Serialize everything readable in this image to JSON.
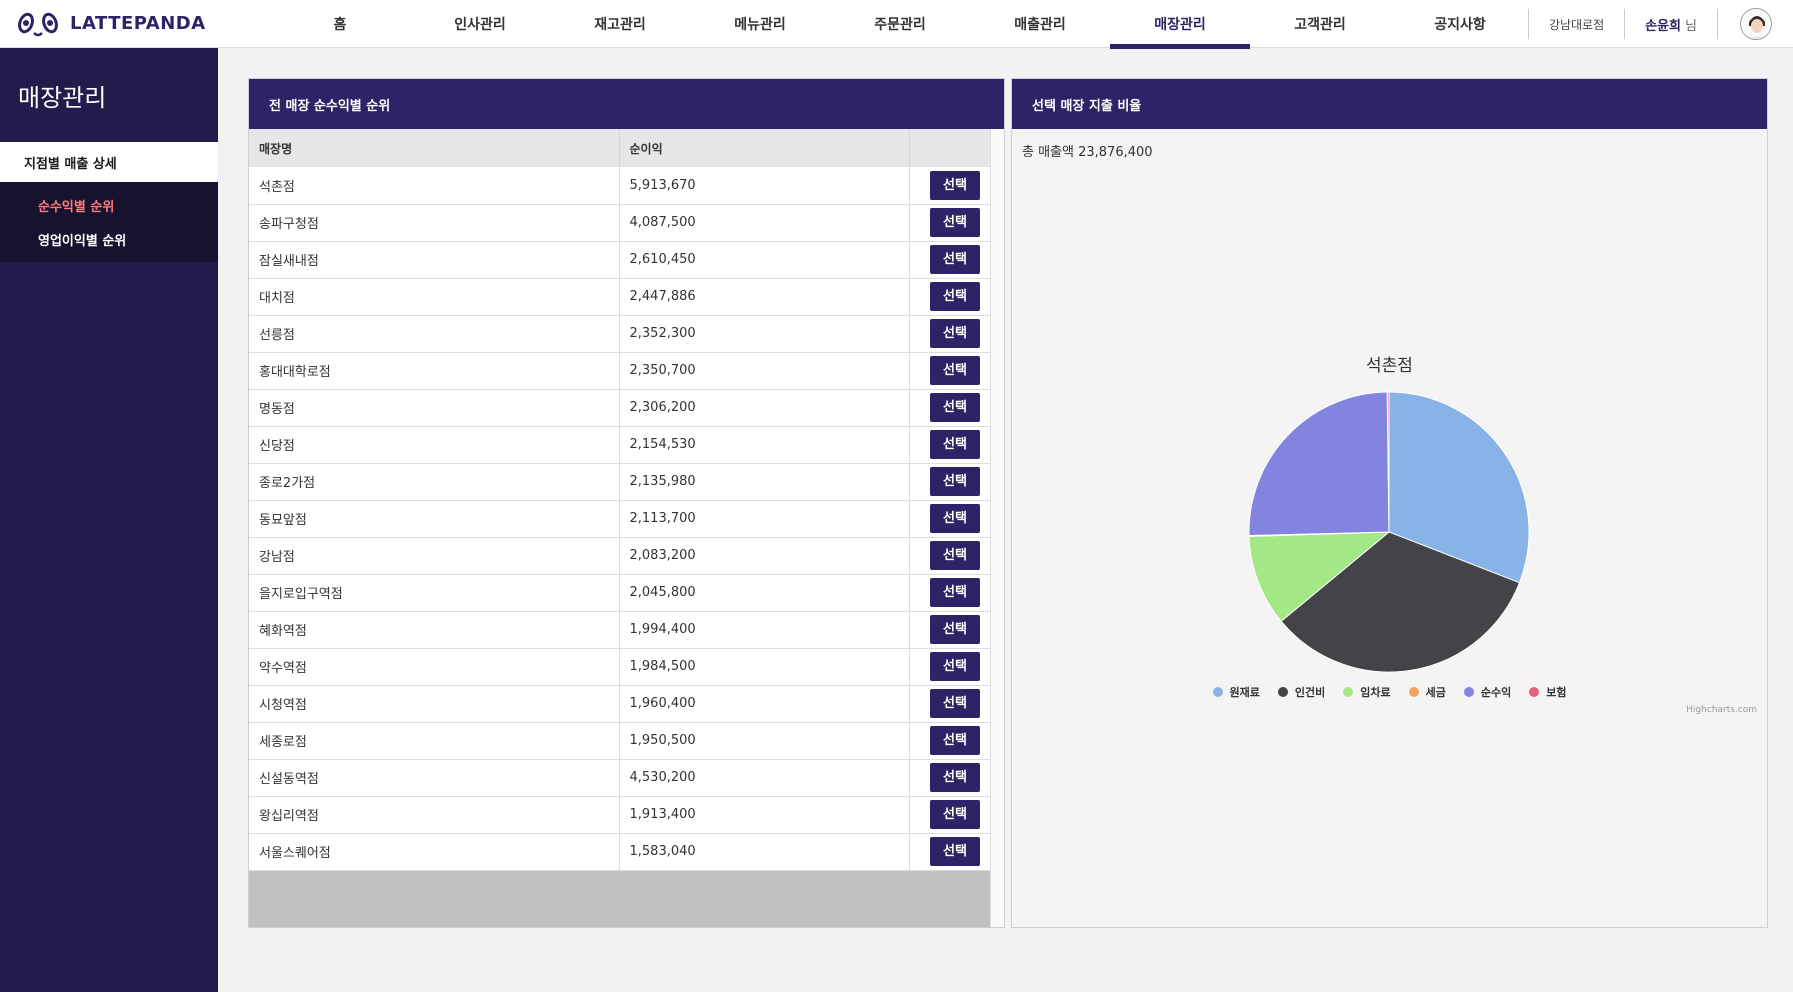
{
  "brand": {
    "name": "LATTEPANDA"
  },
  "nav": {
    "items": [
      "홈",
      "인사관리",
      "재고관리",
      "메뉴관리",
      "주문관리",
      "매출관리",
      "매장관리",
      "고객관리",
      "공지사항"
    ],
    "active": "매장관리"
  },
  "header": {
    "store": "강남대로점",
    "user_name": "손윤희",
    "user_suffix": "님"
  },
  "sidebar": {
    "title": "매장관리",
    "group": "지점별 매출 상세",
    "items": [
      "순수익별 순위",
      "영업이익별 순위"
    ],
    "active": "순수익별 순위"
  },
  "left_panel": {
    "title": "전 매장 순수익별 순위",
    "columns": [
      "매장명",
      "순이익"
    ],
    "button_label": "선택",
    "rows": [
      {
        "name": "석촌점",
        "profit": "5,913,670"
      },
      {
        "name": "송파구청점",
        "profit": "4,087,500"
      },
      {
        "name": "잠실새내점",
        "profit": "2,610,450"
      },
      {
        "name": "대치점",
        "profit": "2,447,886"
      },
      {
        "name": "선릉점",
        "profit": "2,352,300"
      },
      {
        "name": "홍대대학로점",
        "profit": "2,350,700"
      },
      {
        "name": "명동점",
        "profit": "2,306,200"
      },
      {
        "name": "신당점",
        "profit": "2,154,530"
      },
      {
        "name": "종로2가점",
        "profit": "2,135,980"
      },
      {
        "name": "동묘앞점",
        "profit": "2,113,700"
      },
      {
        "name": "강남점",
        "profit": "2,083,200"
      },
      {
        "name": "을지로입구역점",
        "profit": "2,045,800"
      },
      {
        "name": "혜화역점",
        "profit": "1,994,400"
      },
      {
        "name": "약수역점",
        "profit": "1,984,500"
      },
      {
        "name": "시청역점",
        "profit": "1,960,400"
      },
      {
        "name": "세종로점",
        "profit": "1,950,500"
      },
      {
        "name": "신설동역점",
        "profit": "4,530,200"
      },
      {
        "name": "왕십리역점",
        "profit": "1,913,400"
      },
      {
        "name": "서울스퀘어점",
        "profit": "1,583,040"
      }
    ]
  },
  "right_panel": {
    "title": "선택 매장 지출 비율",
    "total_text": "총 매출액 23,876,400",
    "credit": "Highcharts.com"
  },
  "chart_data": {
    "type": "pie",
    "title": "석촌점",
    "legend_position": "bottom",
    "slices": [
      {
        "name": "원재료",
        "value": 30.9,
        "color": "#88b3e6"
      },
      {
        "name": "인건비",
        "value": 33.1,
        "color": "#434348"
      },
      {
        "name": "임차료",
        "value": 10.5,
        "color": "#a3e884"
      },
      {
        "name": "세금",
        "value": 0.1,
        "color": "#f3a35e"
      },
      {
        "name": "순수익",
        "value": 25.2,
        "color": "#8383e0"
      },
      {
        "name": "보험",
        "value": 0.2,
        "color": "#e4617f"
      }
    ]
  }
}
